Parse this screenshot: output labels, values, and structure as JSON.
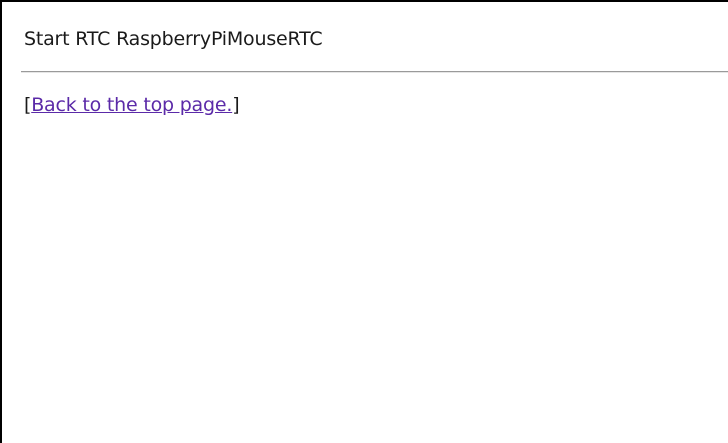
{
  "page": {
    "status_text": "Start RTC RaspberryPiMouseRTC",
    "back_link": {
      "open_bracket": "[",
      "label": "Back to the top page.",
      "close_bracket": "]"
    }
  },
  "colors": {
    "link": "#5b2aa8",
    "text": "#1a1a1a",
    "rule": "#9a9a9a",
    "frame_border": "#000000"
  }
}
